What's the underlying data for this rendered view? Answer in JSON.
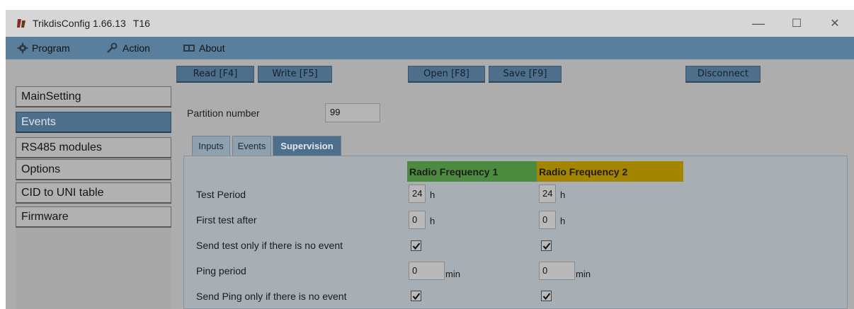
{
  "window": {
    "title": "TrikdisConfig 1.66.13",
    "device": "T16",
    "controls": {
      "minimize": "—",
      "maximize": "☐",
      "close": "✕"
    }
  },
  "menu": {
    "program": "Program",
    "action": "Action",
    "about": "About"
  },
  "toolbar": {
    "read": "Read [F4]",
    "write": "Write [F5]",
    "open": "Open [F8]",
    "save": "Save [F9]",
    "disconnect": "Disconnect"
  },
  "nav": {
    "items": [
      {
        "label": "MainSetting"
      },
      {
        "label": "Events"
      },
      {
        "label": "RS485 modules"
      },
      {
        "label": "Options"
      },
      {
        "label": "CID to UNI table"
      },
      {
        "label": "Firmware"
      }
    ],
    "active": "Events"
  },
  "partition": {
    "label": "Partition number",
    "value": "99"
  },
  "tabs": [
    {
      "label": "Inputs"
    },
    {
      "label": "Events"
    },
    {
      "label": "Supervision"
    }
  ],
  "active_tab": "Supervision",
  "supervision": {
    "rf1_header": "Radio Frequency 1",
    "rf2_header": "Radio Frequency 2",
    "rows": [
      {
        "label": "Test Period",
        "rf1": "24",
        "rf2": "24",
        "unit": "h"
      },
      {
        "label": "First test after",
        "rf1": "0",
        "rf2": "0",
        "unit": "h"
      },
      {
        "label": "Send test only if there is no event",
        "rf1_checked": true,
        "rf2_checked": true
      },
      {
        "label": "Ping period",
        "rf1": "0",
        "rf2": "0",
        "unit": "min"
      },
      {
        "label": "Send Ping only if there is no event",
        "rf1_checked": true,
        "rf2_checked": true
      }
    ]
  },
  "colors": {
    "accent": "#4d6f8b",
    "rf1": "#4c8a3f",
    "rf2": "#a48500"
  }
}
